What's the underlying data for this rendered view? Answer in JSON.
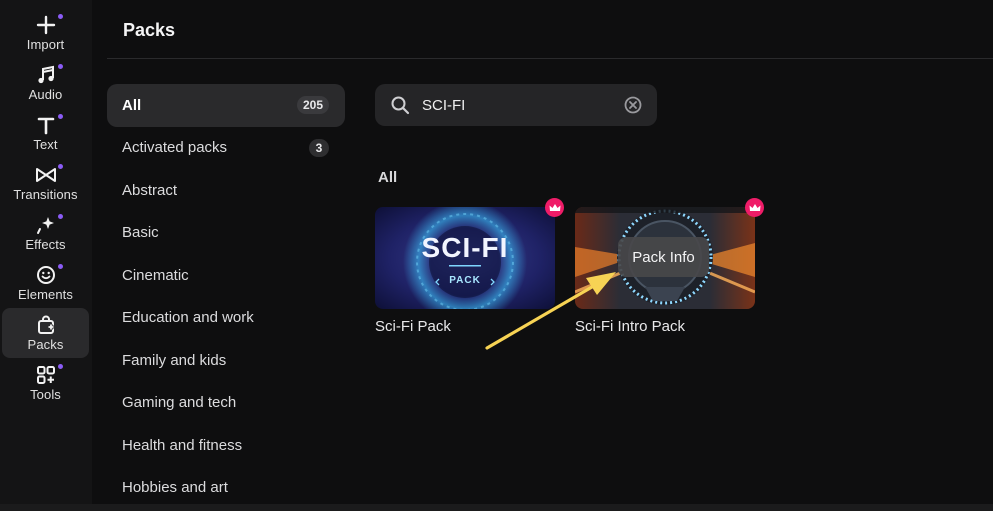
{
  "sidebar": {
    "items": [
      {
        "label": "Import",
        "icon": "plus-icon",
        "active": false
      },
      {
        "label": "Audio",
        "icon": "music-note-icon",
        "active": false
      },
      {
        "label": "Text",
        "icon": "text-icon",
        "active": false
      },
      {
        "label": "Transitions",
        "icon": "transitions-icon",
        "active": false
      },
      {
        "label": "Effects",
        "icon": "sparkle-icon",
        "active": false
      },
      {
        "label": "Elements",
        "icon": "smiley-icon",
        "active": false
      },
      {
        "label": "Packs",
        "icon": "bag-icon",
        "active": true
      },
      {
        "label": "Tools",
        "icon": "grid-plus-icon",
        "active": false
      }
    ],
    "dot_color": "#8b5cf6"
  },
  "header": {
    "title": "Packs"
  },
  "categories": [
    {
      "label": "All",
      "count": "205",
      "active": true
    },
    {
      "label": "Activated packs",
      "count": "3",
      "active": false
    },
    {
      "label": "Abstract"
    },
    {
      "label": "Basic"
    },
    {
      "label": "Cinematic"
    },
    {
      "label": "Education and work"
    },
    {
      "label": "Family and kids"
    },
    {
      "label": "Gaming and tech"
    },
    {
      "label": "Health and fitness"
    },
    {
      "label": "Hobbies and art"
    }
  ],
  "search": {
    "value": "SCI-FI"
  },
  "results": {
    "section_label": "All",
    "cards": [
      {
        "name": "Sci-Fi Pack",
        "thumb_title": "SCI-FI",
        "thumb_sub": "PACK",
        "premium": true
      },
      {
        "name": "Sci-Fi Intro Pack",
        "tooltip": "Pack Info",
        "premium": true
      }
    ]
  },
  "colors": {
    "crown": "#ef1c68",
    "arrow": "#f7d354",
    "accent": "#8b5cf6"
  }
}
